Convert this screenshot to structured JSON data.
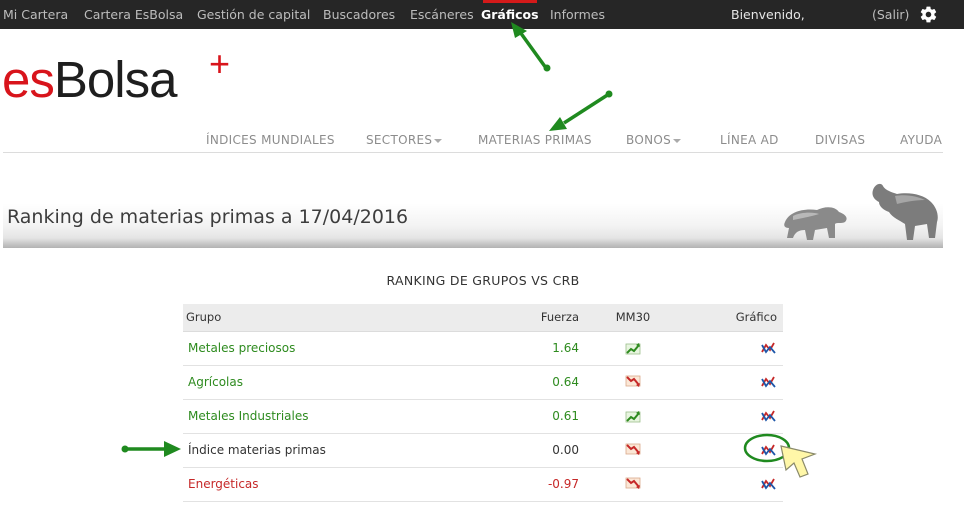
{
  "topnav": {
    "items": [
      "Mi Cartera",
      "Cartera EsBolsa",
      "Gestión de capital",
      "Buscadores",
      "Escáneres",
      "Gráficos",
      "Informes"
    ],
    "active": "Gráficos",
    "welcome": "Bienvenido,",
    "logout": "(Salir)",
    "settings_icon": "gear-icon"
  },
  "logo": {
    "part1": "es",
    "part2": "Bolsa",
    "plus": "+"
  },
  "secnav": {
    "items": [
      "ÍNDICES MUNDIALES",
      "SECTORES",
      "MATERIAS PRIMAS",
      "BONOS",
      "LÍNEA AD",
      "DIVISAS",
      "AYUDA"
    ]
  },
  "banner": {
    "title": "Ranking de materias primas a 17/04/2016"
  },
  "ranking": {
    "title": "RANKING DE GRUPOS VS CRB",
    "headers": {
      "grupo": "Grupo",
      "fuerza": "Fuerza",
      "mm30": "MM30",
      "grafico": "Gráfico"
    },
    "rows": [
      {
        "grupo": "Metales preciosos",
        "fuerza": "1.64",
        "trend": "up",
        "status": "positive"
      },
      {
        "grupo": "Agrícolas",
        "fuerza": "0.64",
        "trend": "down",
        "status": "positive"
      },
      {
        "grupo": "Metales Industriales",
        "fuerza": "0.61",
        "trend": "up",
        "status": "positive"
      },
      {
        "grupo": "Índice materias primas",
        "fuerza": "0.00",
        "trend": "down",
        "status": "neutral"
      },
      {
        "grupo": "Energéticas",
        "fuerza": "-0.97",
        "trend": "down",
        "status": "negative"
      }
    ]
  },
  "colors": {
    "topbar": "#262626",
    "active_marker": "#d41a1a",
    "positive": "#2e8b1f",
    "negative": "#c62828",
    "annotation": "#1f8a1f",
    "cursor": "#fff7a8"
  }
}
